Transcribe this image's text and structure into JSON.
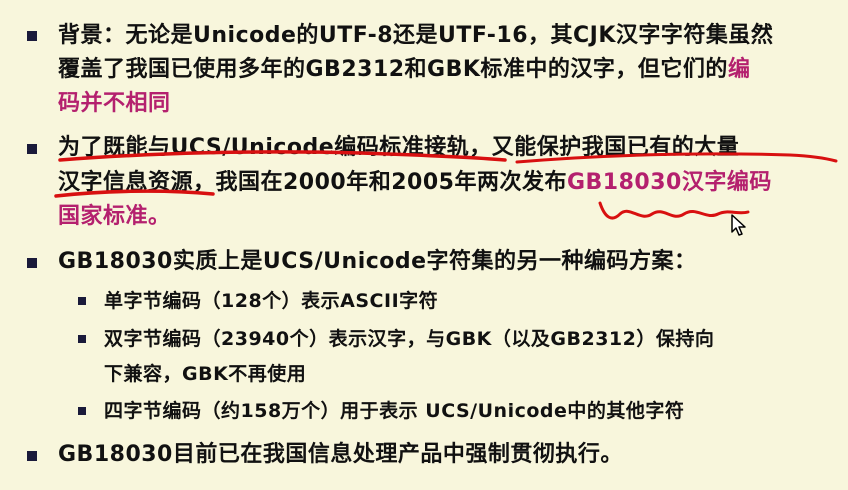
{
  "colors": {
    "background": "#f8f6dc",
    "text": "#111111",
    "accent": "#b4206e",
    "ink": "#d81010",
    "bullet": "#1a1a3a"
  },
  "p1": {
    "l1": "背景：无论是Unicode的UTF-8还是UTF-16，其CJK汉字字符集虽然",
    "l2a": "覆盖了我国已使用多年的GB2312和GBK标准中的汉字，但它们的",
    "l2b": "编",
    "l3": "码并不相同"
  },
  "p2": {
    "l1": "为了既能与UCS/Unicode编码标准接轨，又能保护我国已有的大量",
    "l2a": "汉字信息资源，我国在2000年和2005年两次发布",
    "l2b": "GB18030汉字编码",
    "l3": "国家标准。"
  },
  "p3": {
    "l1": "GB18030实质上是UCS/Unicode字符集的另一种编码方案：",
    "s1": "单字节编码（128个）表示ASCII字符",
    "s2a": "双字节编码（23940个）表示汉字，与GBK（以及GB2312）保持向",
    "s2b": "下兼容，GBK不再使用",
    "s3": "四字节编码（约158万个）用于表示 UCS/Unicode中的其他字符"
  },
  "p4": {
    "l1": "GB18030目前已在我国信息处理产品中强制贯彻执行。"
  },
  "icons": {
    "cursor": "mouse-pointer-icon",
    "bullet": "square-bullet-icon"
  }
}
